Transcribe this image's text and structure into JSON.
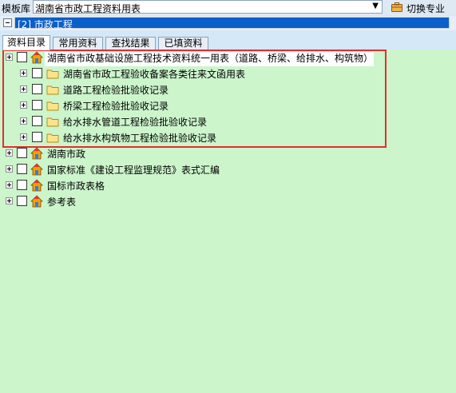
{
  "toolbar": {
    "label": "模板库",
    "combo_value": "湖南省市政工程资料用表",
    "switch_label": "切换专业"
  },
  "category": {
    "value": "[2] 市政工程"
  },
  "tabs": [
    {
      "label": "资料目录",
      "active": true
    },
    {
      "label": "常用资料",
      "active": false
    },
    {
      "label": "查找结果",
      "active": false
    },
    {
      "label": "已填资料",
      "active": false
    }
  ],
  "tree": {
    "root": {
      "label": "湖南省市政基础设施工程技术资料统一用表（道路、桥梁、给排水、构筑物）",
      "icon": "house-icon"
    },
    "children": [
      {
        "label": "湖南省市政工程验收备案各类往来文函用表",
        "icon": "folder-icon"
      },
      {
        "label": "道路工程检验批验收记录",
        "icon": "folder-icon"
      },
      {
        "label": "桥梁工程检验批验收记录",
        "icon": "folder-icon"
      },
      {
        "label": "给水排水管道工程检验批验收记录",
        "icon": "folder-icon"
      },
      {
        "label": "给水排水构筑物工程检验批验收记录",
        "icon": "folder-icon"
      }
    ],
    "siblings": [
      {
        "label": "湖南市政",
        "icon": "house-icon"
      },
      {
        "label": "国家标准《建设工程监理规范》表式汇编",
        "icon": "house-icon"
      },
      {
        "label": "国标市政表格",
        "icon": "house-icon"
      },
      {
        "label": "参考表",
        "icon": "house-icon"
      }
    ]
  },
  "colors": {
    "tree_background": "#ccf5cc",
    "selection": "#0a5fc8",
    "highlight_frame": "#e03030"
  }
}
